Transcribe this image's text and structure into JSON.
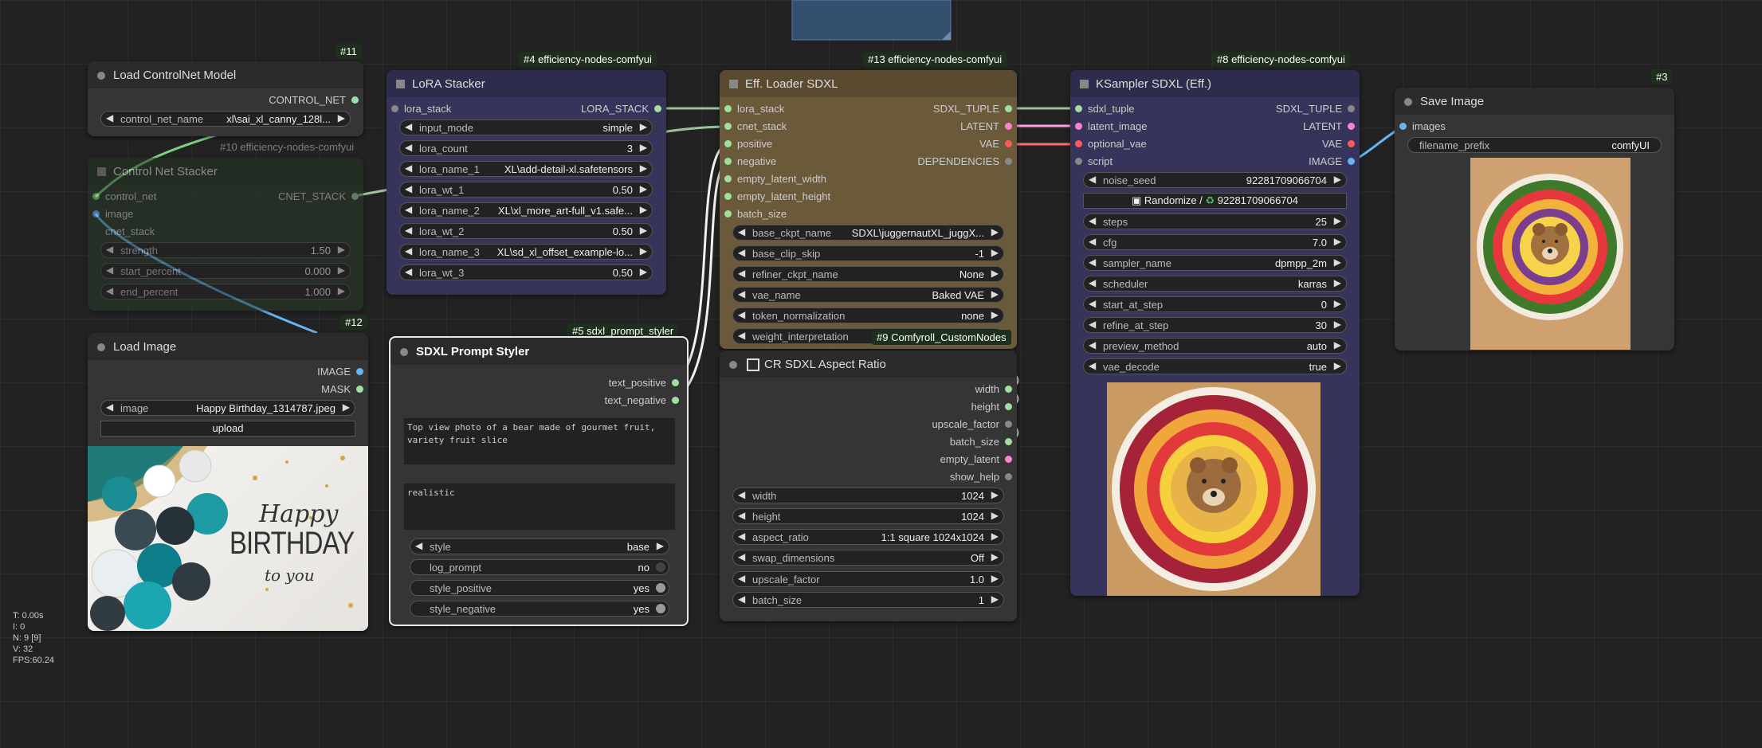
{
  "nodes": {
    "load_controlnet": {
      "badge": "#11",
      "title": "Load ControlNet Model",
      "output_control_net": "CONTROL_NET",
      "control_net_name_label": "control_net_name",
      "control_net_name_value": "xl\\sai_xl_canny_128l..."
    },
    "controlnet_stacker": {
      "badge": "#10 efficiency-nodes-comfyui",
      "title": "Control Net Stacker",
      "input_control_net": "control_net",
      "input_image": "image",
      "input_cnet_stack": "cnet_stack",
      "output_cnet_stack": "CNET_STACK",
      "strength_label": "strength",
      "strength_value": "1.50",
      "start_percent_label": "start_percent",
      "start_percent_value": "0.000",
      "end_percent_label": "end_percent",
      "end_percent_value": "1.000"
    },
    "load_image": {
      "badge": "#12",
      "title": "Load Image",
      "output_image": "IMAGE",
      "output_mask": "MASK",
      "image_label": "image",
      "image_value": "Happy Birthday_1314787.jpeg",
      "upload_label": "upload",
      "preview_line1": "Happy",
      "preview_line2": "BIRTHDAY",
      "preview_line3": "to you"
    },
    "lora_stacker": {
      "badge": "#4 efficiency-nodes-comfyui",
      "title": "LoRA Stacker",
      "input_lora_stack": "lora_stack",
      "output_lora_stack": "LORA_STACK",
      "widgets": [
        {
          "label": "input_mode",
          "value": "simple"
        },
        {
          "label": "lora_count",
          "value": "3"
        },
        {
          "label": "lora_name_1",
          "value": "XL\\add-detail-xl.safetensors"
        },
        {
          "label": "lora_wt_1",
          "value": "0.50"
        },
        {
          "label": "lora_name_2",
          "value": "XL\\xl_more_art-full_v1.safe..."
        },
        {
          "label": "lora_wt_2",
          "value": "0.50"
        },
        {
          "label": "lora_name_3",
          "value": "XL\\sd_xl_offset_example-lo..."
        },
        {
          "label": "lora_wt_3",
          "value": "0.50"
        }
      ]
    },
    "prompt_styler": {
      "badge": "#5 sdxl_prompt_styler",
      "title": "SDXL Prompt Styler",
      "output_text_positive": "text_positive",
      "output_text_negative": "text_negative",
      "text_positive_value": "Top view photo of a bear made of gourmet fruit, variety fruit slice",
      "text_negative_value": "realistic",
      "style_label": "style",
      "style_value": "base",
      "log_prompt_label": "log_prompt",
      "log_prompt_value": "no",
      "style_positive_label": "style_positive",
      "style_positive_value": "yes",
      "style_negative_label": "style_negative",
      "style_negative_value": "yes"
    },
    "eff_loader": {
      "badge": "#13 efficiency-nodes-comfyui",
      "title": "Eff. Loader SDXL",
      "inputs": [
        "lora_stack",
        "cnet_stack",
        "positive",
        "negative",
        "empty_latent_width",
        "empty_latent_height",
        "batch_size"
      ],
      "outputs": [
        "SDXL_TUPLE",
        "LATENT",
        "VAE",
        "DEPENDENCIES"
      ],
      "widgets": [
        {
          "label": "base_ckpt_name",
          "value": "SDXL\\juggernautXL_juggX..."
        },
        {
          "label": "base_clip_skip",
          "value": "-1"
        },
        {
          "label": "refiner_ckpt_name",
          "value": "None"
        },
        {
          "label": "vae_name",
          "value": "Baked VAE"
        },
        {
          "label": "token_normalization",
          "value": "none"
        },
        {
          "label": "weight_interpretation",
          "value": ""
        }
      ]
    },
    "aspect_ratio": {
      "badge": "#9 Comfyroll_CustomNodes",
      "title": "CR SDXL Aspect Ratio",
      "outputs": [
        "width",
        "height",
        "upscale_factor",
        "batch_size",
        "empty_latent",
        "show_help"
      ],
      "widgets": [
        {
          "label": "width",
          "value": "1024"
        },
        {
          "label": "height",
          "value": "1024"
        },
        {
          "label": "aspect_ratio",
          "value": "1:1 square 1024x1024"
        },
        {
          "label": "swap_dimensions",
          "value": "Off"
        },
        {
          "label": "upscale_factor",
          "value": "1.0"
        },
        {
          "label": "batch_size",
          "value": "1"
        }
      ]
    },
    "ksampler": {
      "badge": "#8 efficiency-nodes-comfyui",
      "title": "KSampler SDXL (Eff.)",
      "inputs": [
        "sdxl_tuple",
        "latent_image",
        "optional_vae",
        "script"
      ],
      "outputs": [
        "SDXL_TUPLE",
        "LATENT",
        "VAE",
        "IMAGE"
      ],
      "noise_seed_label": "noise_seed",
      "noise_seed_value": "92281709066704",
      "randomize_label": "Randomize / ",
      "randomize_value": "92281709066704",
      "widgets": [
        {
          "label": "steps",
          "value": "25"
        },
        {
          "label": "cfg",
          "value": "7.0"
        },
        {
          "label": "sampler_name",
          "value": "dpmpp_2m"
        },
        {
          "label": "scheduler",
          "value": "karras"
        },
        {
          "label": "start_at_step",
          "value": "0"
        },
        {
          "label": "refine_at_step",
          "value": "30"
        },
        {
          "label": "preview_method",
          "value": "auto"
        },
        {
          "label": "vae_decode",
          "value": "true"
        }
      ]
    },
    "save_image": {
      "badge": "#3",
      "title": "Save Image",
      "input_images": "images",
      "filename_prefix_label": "filename_prefix",
      "filename_prefix_value": "comfyUI"
    }
  },
  "stats": {
    "t": "T: 0.00s",
    "i": "I: 0",
    "n": "N: 9 [9]",
    "v": "V: 32",
    "fps": "FPS:60.24"
  },
  "colors": {
    "canvas": "#222222",
    "node_body": "#353535",
    "node_header": "#2b2b2b",
    "eff_loader": "#6b5a3a",
    "ksampler": "#36345a",
    "lora_stacker": "#36345a",
    "controlnet_stacker": "#2f4530",
    "socket_green": "#7fe07f",
    "socket_pink": "#ff7fd4",
    "socket_red": "#ff5a5a",
    "socket_blue": "#64b5f6"
  }
}
